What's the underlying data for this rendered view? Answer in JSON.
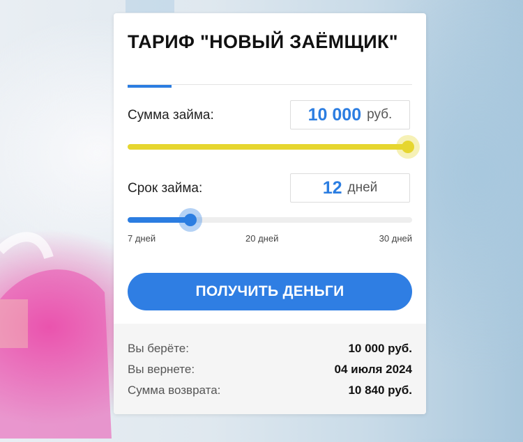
{
  "card": {
    "title": "ТАРИФ \"НОВЫЙ ЗАЁМЩИК\""
  },
  "amount": {
    "label": "Сумма займа:",
    "value": "10 000",
    "unit": "руб.",
    "slider_level": 1.0
  },
  "term": {
    "label": "Срок займа:",
    "value": "12",
    "unit": "дней",
    "slider_level": 0.22,
    "ticks": [
      "7 дней",
      "20 дней",
      "30 дней"
    ]
  },
  "cta": {
    "label": "ПОЛУЧИТЬ ДЕНЬГИ"
  },
  "summary": {
    "rows": [
      {
        "label": "Вы берёте:",
        "value": "10 000 руб."
      },
      {
        "label": "Вы вернете:",
        "value": "04 июля 2024"
      },
      {
        "label": "Сумма возврата:",
        "value": "10 840 руб."
      }
    ]
  },
  "colors": {
    "accent_blue": "#2b7de1",
    "amount_slider": "#e6d62f",
    "cta_background": "#2f7ee3"
  }
}
